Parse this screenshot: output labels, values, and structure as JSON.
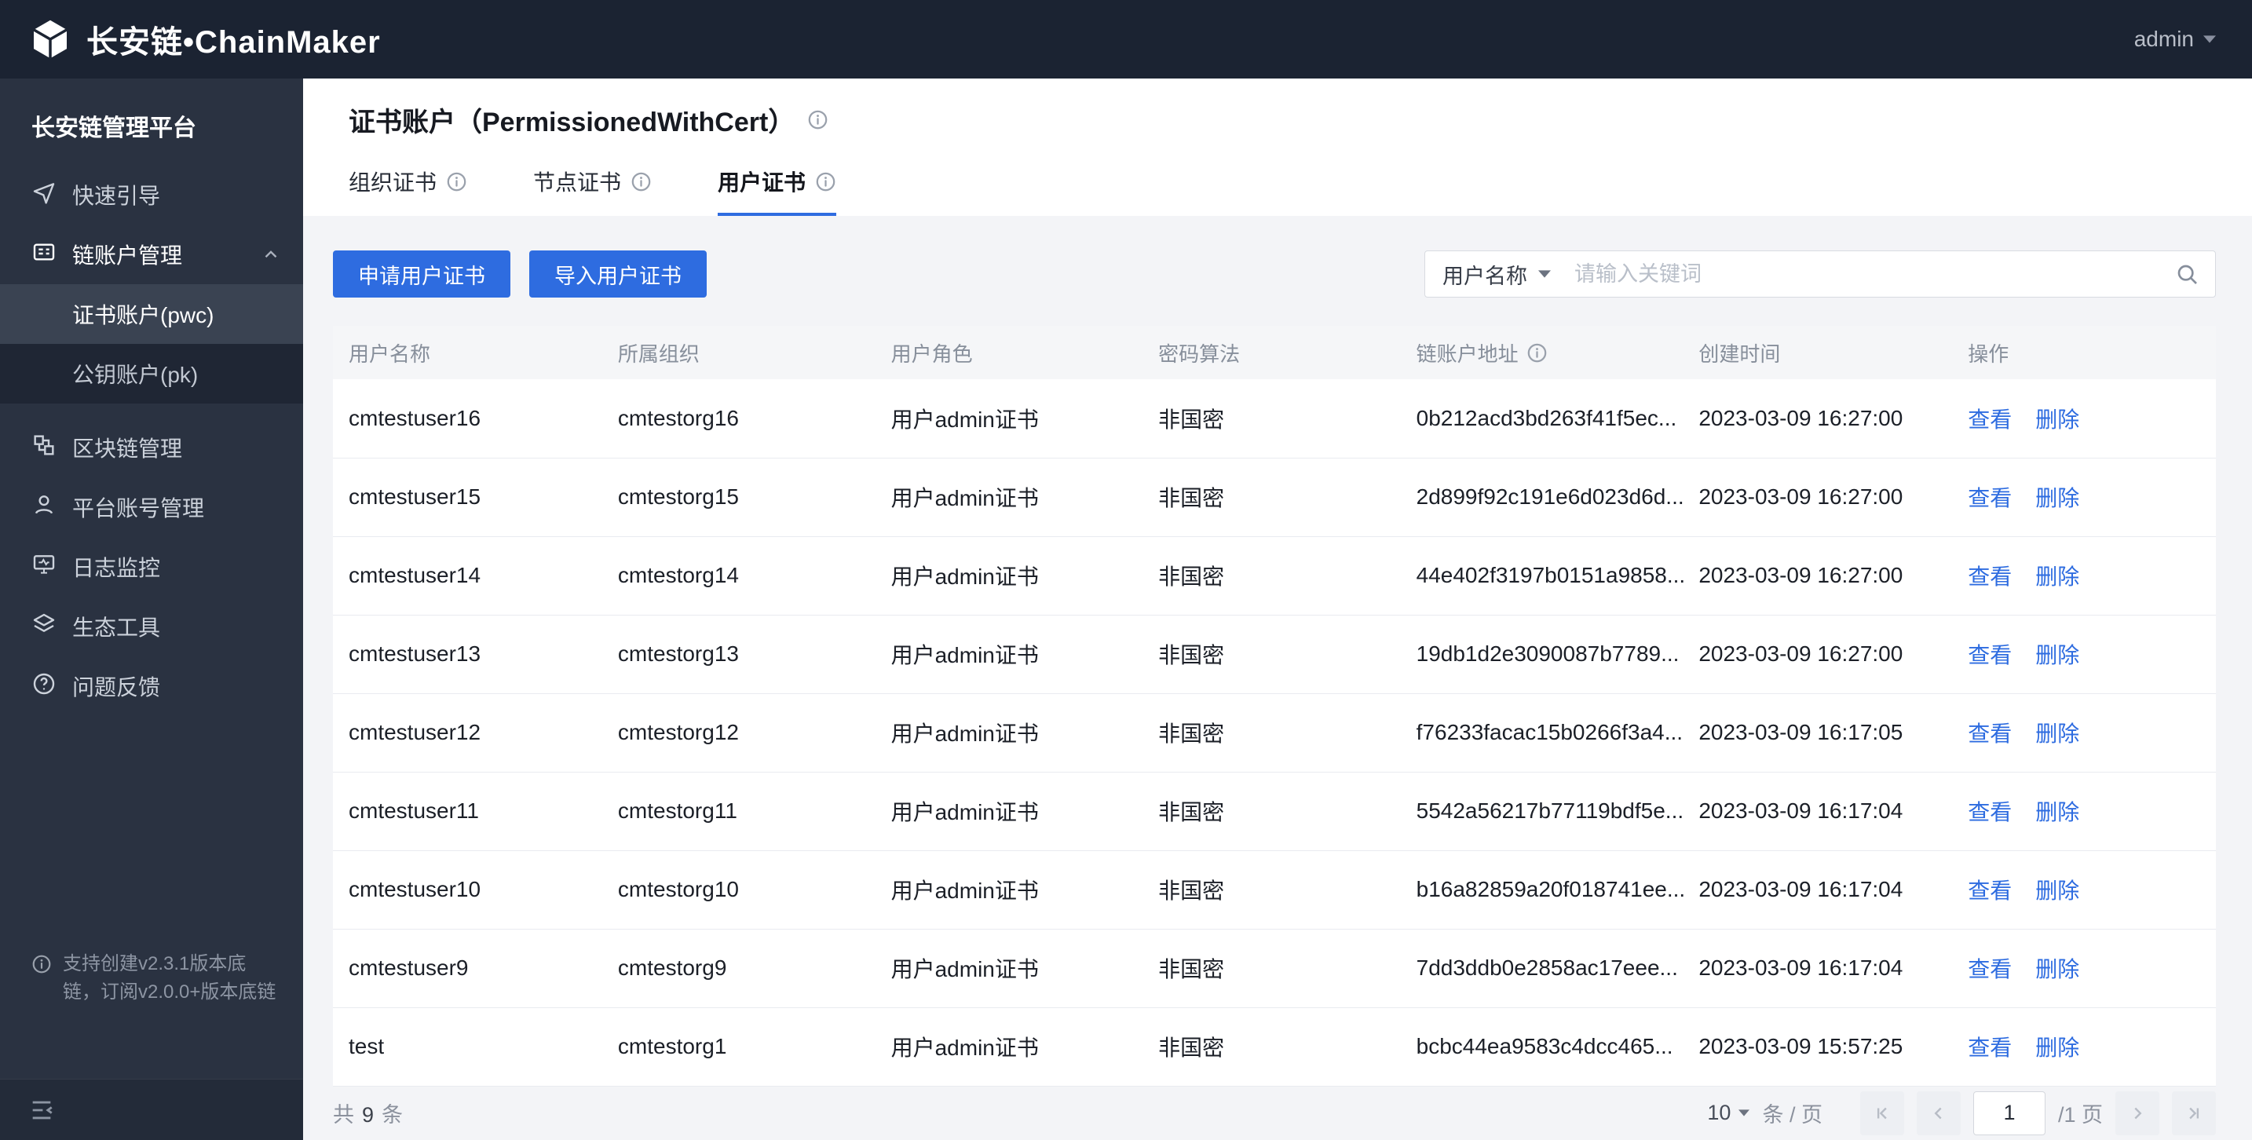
{
  "topbar": {
    "logo": "长安链•ChainMaker",
    "user": "admin"
  },
  "sidebar": {
    "title": "长安链管理平台",
    "items": [
      {
        "label": "快速引导"
      },
      {
        "label": "链账户管理"
      },
      {
        "label": "区块链管理"
      },
      {
        "label": "平台账号管理"
      },
      {
        "label": "日志监控"
      },
      {
        "label": "生态工具"
      },
      {
        "label": "问题反馈"
      }
    ],
    "submenu": [
      {
        "label": "证书账户(pwc)"
      },
      {
        "label": "公钥账户(pk)"
      }
    ],
    "footer_note": "支持创建v2.3.1版本底链，订阅v2.0.0+版本底链"
  },
  "page": {
    "title": "证书账户（PermissionedWithCert）",
    "tabs": [
      {
        "label": "组织证书"
      },
      {
        "label": "节点证书"
      },
      {
        "label": "用户证书"
      }
    ]
  },
  "toolbar": {
    "apply_button": "申请用户证书",
    "import_button": "导入用户证书",
    "search_field": "用户名称",
    "search_placeholder": "请输入关键词"
  },
  "table": {
    "columns": [
      "用户名称",
      "所属组织",
      "用户角色",
      "密码算法",
      "链账户地址",
      "创建时间",
      "操作"
    ],
    "actions": {
      "view": "查看",
      "delete": "删除"
    },
    "rows": [
      {
        "name": "cmtestuser16",
        "org": "cmtestorg16",
        "role": "用户admin证书",
        "algo": "非国密",
        "address": "0b212acd3bd263f41f5ec...",
        "created": "2023-03-09 16:27:00"
      },
      {
        "name": "cmtestuser15",
        "org": "cmtestorg15",
        "role": "用户admin证书",
        "algo": "非国密",
        "address": "2d899f92c191e6d023d6d...",
        "created": "2023-03-09 16:27:00"
      },
      {
        "name": "cmtestuser14",
        "org": "cmtestorg14",
        "role": "用户admin证书",
        "algo": "非国密",
        "address": "44e402f3197b0151a9858...",
        "created": "2023-03-09 16:27:00"
      },
      {
        "name": "cmtestuser13",
        "org": "cmtestorg13",
        "role": "用户admin证书",
        "algo": "非国密",
        "address": "19db1d2e3090087b7789...",
        "created": "2023-03-09 16:27:00"
      },
      {
        "name": "cmtestuser12",
        "org": "cmtestorg12",
        "role": "用户admin证书",
        "algo": "非国密",
        "address": "f76233facac15b0266f3a4...",
        "created": "2023-03-09 16:17:05"
      },
      {
        "name": "cmtestuser11",
        "org": "cmtestorg11",
        "role": "用户admin证书",
        "algo": "非国密",
        "address": "5542a56217b77119bdf5e...",
        "created": "2023-03-09 16:17:04"
      },
      {
        "name": "cmtestuser10",
        "org": "cmtestorg10",
        "role": "用户admin证书",
        "algo": "非国密",
        "address": "b16a82859a20f018741ee...",
        "created": "2023-03-09 16:17:04"
      },
      {
        "name": "cmtestuser9",
        "org": "cmtestorg9",
        "role": "用户admin证书",
        "algo": "非国密",
        "address": "7dd3ddb0e2858ac17eee...",
        "created": "2023-03-09 16:17:04"
      },
      {
        "name": "test",
        "org": "cmtestorg1",
        "role": "用户admin证书",
        "algo": "非国密",
        "address": "bcbc44ea9583c4dcc465...",
        "created": "2023-03-09 15:57:25"
      }
    ]
  },
  "pagination": {
    "total_prefix": "共",
    "total_count": "9",
    "total_suffix": "条",
    "page_size": "10",
    "unit": "条 / 页",
    "current_page": "1",
    "total_pages": "/1 页"
  },
  "colors": {
    "accent": "#2e6ce0",
    "link": "#2e6ce0",
    "topbar_bg": "#1b2332",
    "sidebar_bg": "#2a3241"
  }
}
